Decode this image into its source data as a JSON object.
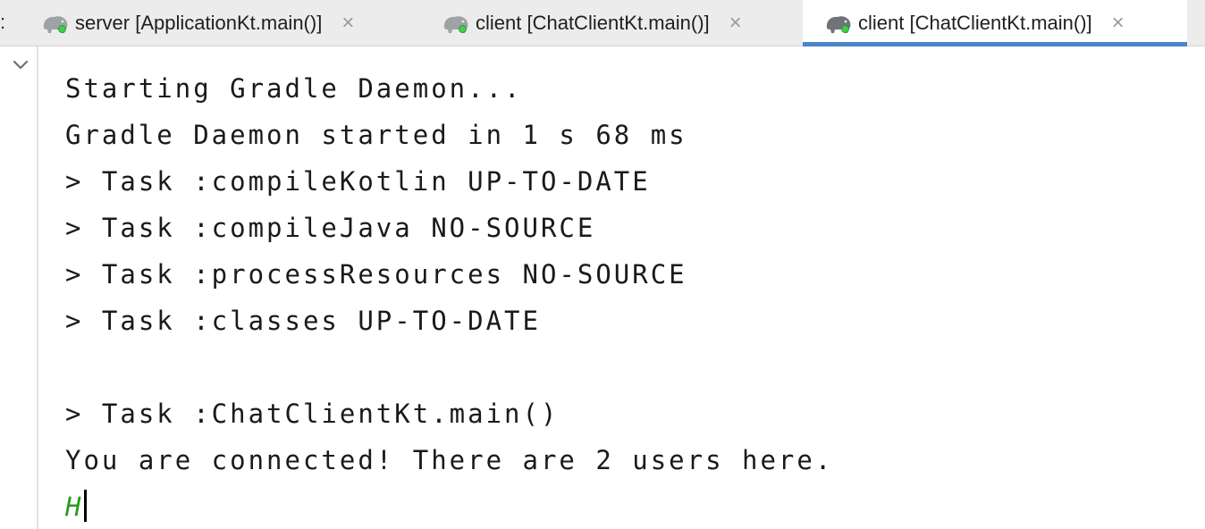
{
  "tabs": [
    {
      "label": "server [ApplicationKt.main()]",
      "active": false
    },
    {
      "label": "client [ChatClientKt.main()]",
      "active": false
    },
    {
      "label": "client [ChatClientKt.main()]",
      "active": true
    }
  ],
  "tab_overflow": ":",
  "tab_icon": "gradle-elephant-icon",
  "tab_close_glyph": "×",
  "colors": {
    "active_tab_underline": "#4a86c8",
    "run_indicator": "#3fcf4a",
    "user_input": "#2a9a1c"
  },
  "console": {
    "lines": [
      "Starting Gradle Daemon...",
      "Gradle Daemon started in 1 s 68 ms",
      "> Task :compileKotlin UP-TO-DATE",
      "> Task :compileJava NO-SOURCE",
      "> Task :processResources NO-SOURCE",
      "> Task :classes UP-TO-DATE",
      "",
      "> Task :ChatClientKt.main()",
      "You are connected! There are 2 users here."
    ],
    "input": "H"
  }
}
